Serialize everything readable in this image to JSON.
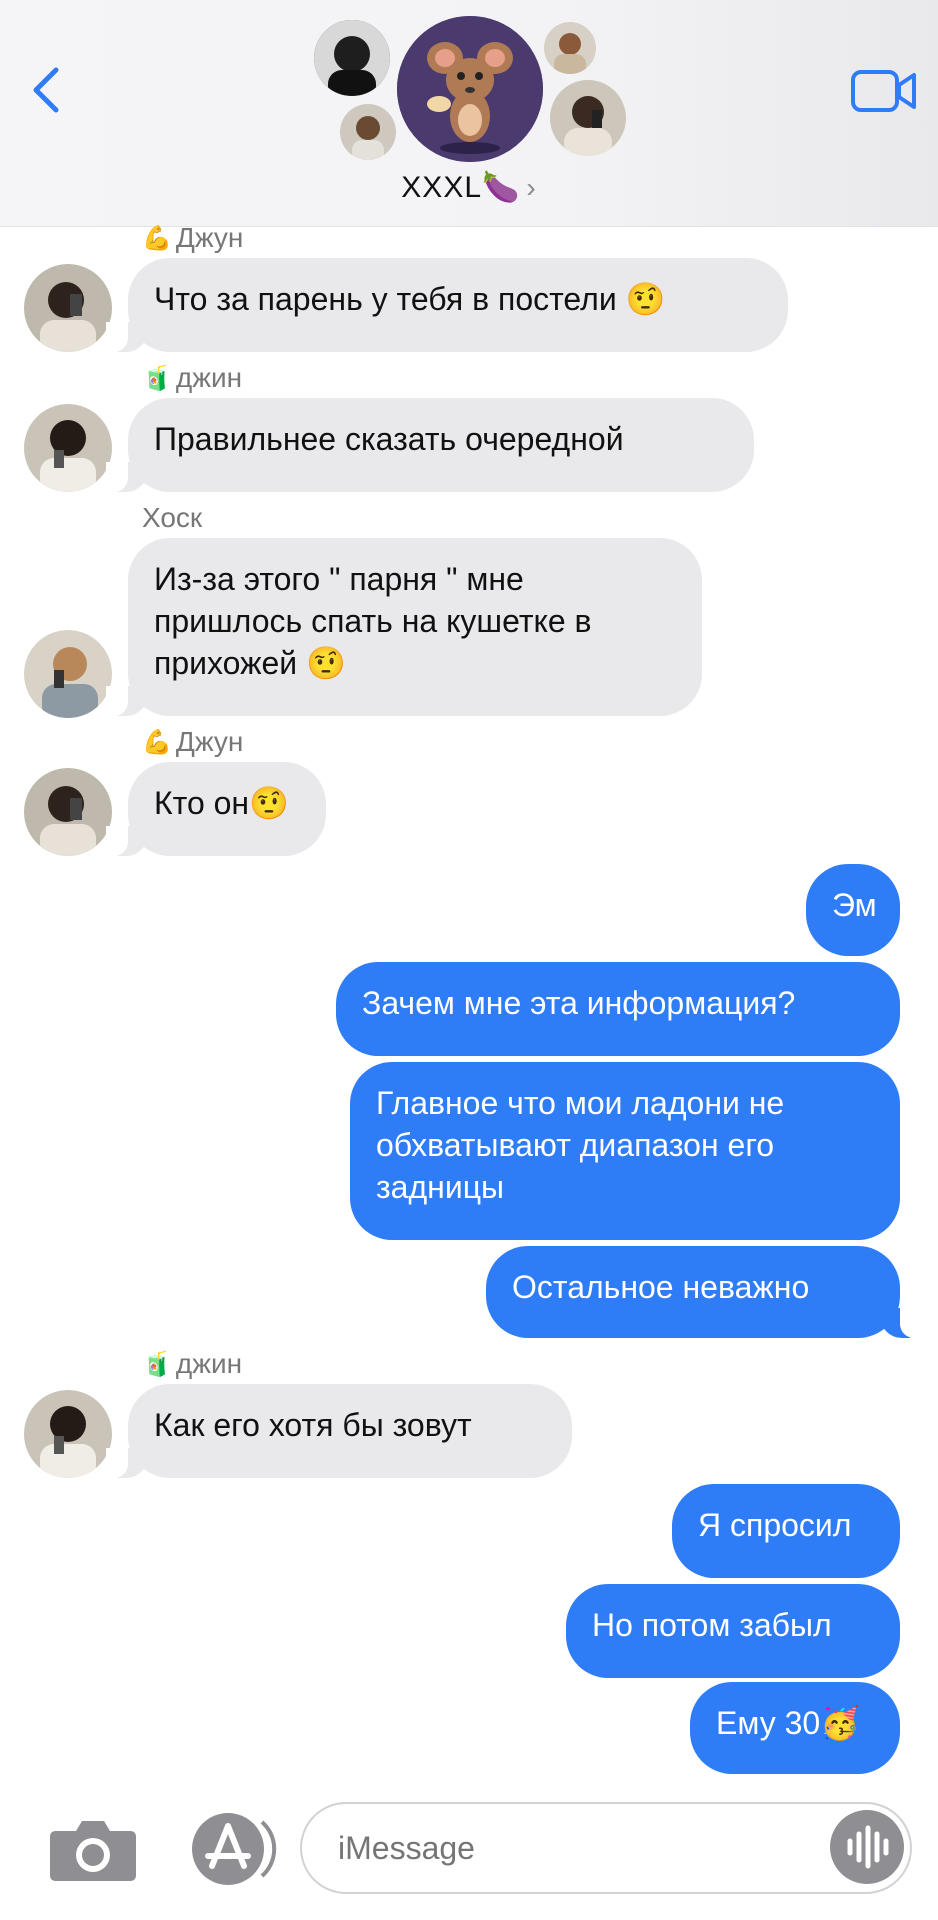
{
  "header": {
    "group_name": "XXXL",
    "group_emoji": "🍆",
    "chevron": "›",
    "back_icon": "chevron-left-icon",
    "video_icon": "video-camera-icon",
    "accent": "#2f7df6"
  },
  "messages": [
    {
      "sender": "Джун",
      "sender_emoji": "💪",
      "text": "Что за парень у тебя в постели 🤨"
    },
    {
      "sender": "джин",
      "sender_emoji": "🧃",
      "text": "Правильнее сказать очередной"
    },
    {
      "sender": "Хоск",
      "sender_emoji": "",
      "text": "Из-за этого \" парня \" мне пришлось спать на кушетке в прихожей 🤨"
    },
    {
      "sender": "Джун",
      "sender_emoji": "💪",
      "text": "Кто он🤨"
    },
    {
      "out": "Эм"
    },
    {
      "out": "Зачем мне эта информация?"
    },
    {
      "out": "Главное что мои ладони  не обхватывают  диапазон его задницы"
    },
    {
      "out": "Остальное неважно"
    },
    {
      "sender": "джин",
      "sender_emoji": "🧃",
      "text": "Как его хотя бы зовут"
    },
    {
      "out": "Я спросил"
    },
    {
      "out": "Но потом забыл"
    },
    {
      "out": "Ему 30🥳"
    }
  ],
  "composer": {
    "placeholder": "iMessage",
    "camera_icon": "camera-icon",
    "apps_icon": "app-store-icon",
    "mic_icon": "audio-waveform-icon"
  }
}
